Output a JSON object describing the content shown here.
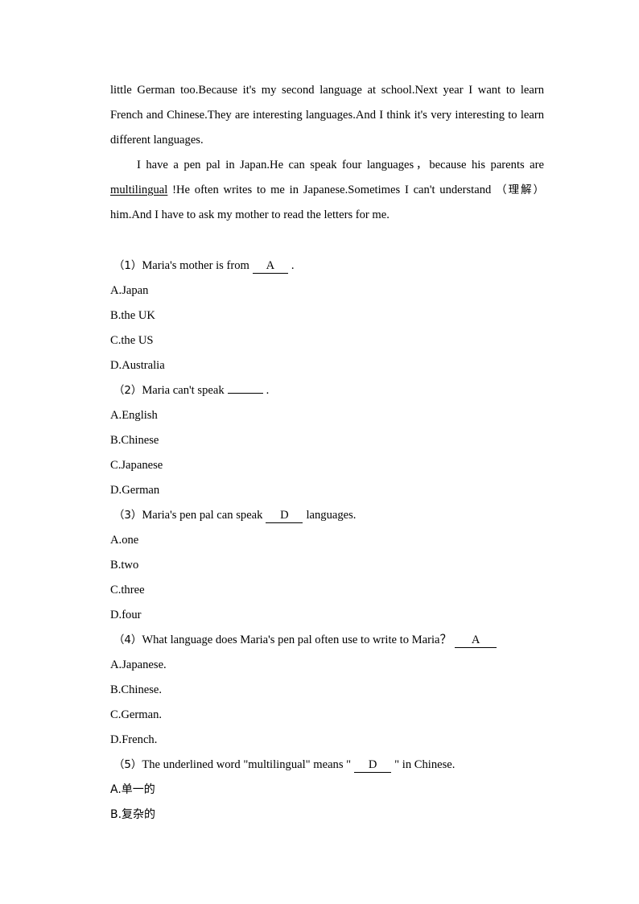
{
  "document": {
    "type": "english-reading-comprehension-worksheet",
    "passage": {
      "paragraph_1": "little German too.Because it's my second language at school.Next year I want to learn French and Chinese.They are interesting languages.And I think it's very interesting to learn different languages.",
      "paragraph_2_part_1": "I have a pen pal in Japan.He can speak four languages",
      "paragraph_2_comma": "，",
      "paragraph_2_part_2": "because his parents are ",
      "paragraph_2_underlined_word": "multilingual",
      "paragraph_2_part_3": " !He often writes to me in Japanese.Sometimes I can't understand ",
      "paragraph_2_gloss": "（理解）",
      "paragraph_2_part_4": "him.And I have to ask my mother to read the letters for me."
    },
    "questions": [
      {
        "number": "（1）",
        "text_before": "Maria's mother is from",
        "answer": "A",
        "answer_filled": true,
        "text_after": ".",
        "options": [
          "A.Japan",
          "B.the UK",
          "C.the US",
          "D.Australia"
        ]
      },
      {
        "number": "（2）",
        "text_before": "Maria can't speak",
        "answer": "",
        "answer_filled": false,
        "text_after": ".",
        "options": [
          "A.English",
          "B.Chinese",
          "C.Japanese",
          "D.German"
        ]
      },
      {
        "number": "（3）",
        "text_before": "Maria's pen pal can speak",
        "answer": "D",
        "answer_filled": true,
        "text_after": "languages.",
        "options": [
          "A.one",
          "B.two",
          "C.three",
          "D.four"
        ]
      },
      {
        "number": "（4）",
        "text_before": "What language does Maria's pen pal often use to write to Maria？",
        "answer": "A",
        "answer_filled": true,
        "text_after": "",
        "options": [
          "A.Japanese.",
          "B.Chinese.",
          "C.German.",
          "D.French."
        ]
      },
      {
        "number": "（5）",
        "text_before": "The underlined word \"multilingual\" means \"",
        "answer": "D",
        "answer_filled": true,
        "text_after": "\" in Chinese.",
        "options": [
          "A.单一的",
          "B.复杂的"
        ]
      }
    ]
  }
}
